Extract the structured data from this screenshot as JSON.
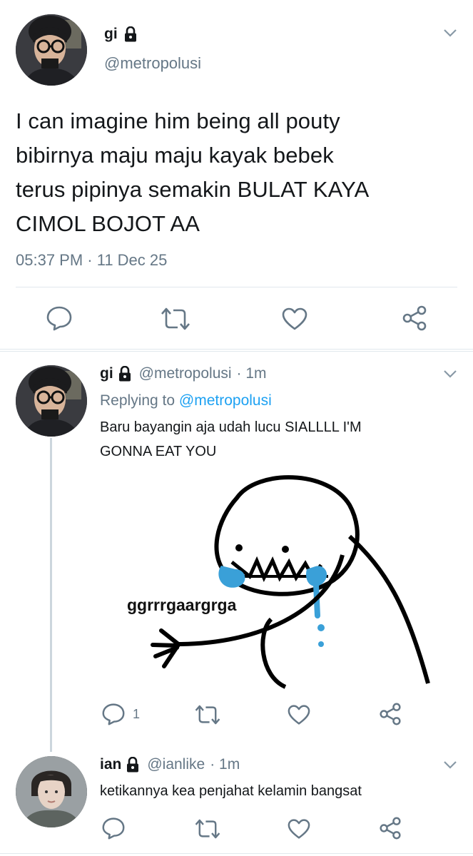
{
  "main_tweet": {
    "name": "gi",
    "handle": "@metropolusi",
    "text_lines": [
      "I can imagine him being all pouty",
      "bibirnya maju maju kayak bebek",
      "terus pipinya semakin BULAT KAYA",
      "CIMOL BOJOT AA"
    ],
    "timestamp": "05:37 PM · 11 Dec 25"
  },
  "reply1": {
    "name": "gi",
    "handle": "@metropolusi",
    "time": "· 1m",
    "replying_prefix": "Replying to",
    "replying_handle": "@metropolusi",
    "text_lines": [
      "Baru bayangin aja udah lucu SIALLLL I'M",
      "GONNA EAT YOU"
    ],
    "image_caption": "ggrrrgaargrga",
    "reply_count": "1"
  },
  "reply2": {
    "name": "ian",
    "handle": "@ianlike",
    "time": "· 1m",
    "text": "ketikannya kea penjahat kelamin bangsat"
  },
  "icons": [
    "lock-icon",
    "chevron-down-icon",
    "reply-icon",
    "retweet-icon",
    "like-icon",
    "share-icon"
  ],
  "colors": {
    "link": "#1da1f2",
    "secondary_text": "#657786",
    "divider": "#e1e8ed",
    "sweat_blue": "#3aa0d8"
  }
}
